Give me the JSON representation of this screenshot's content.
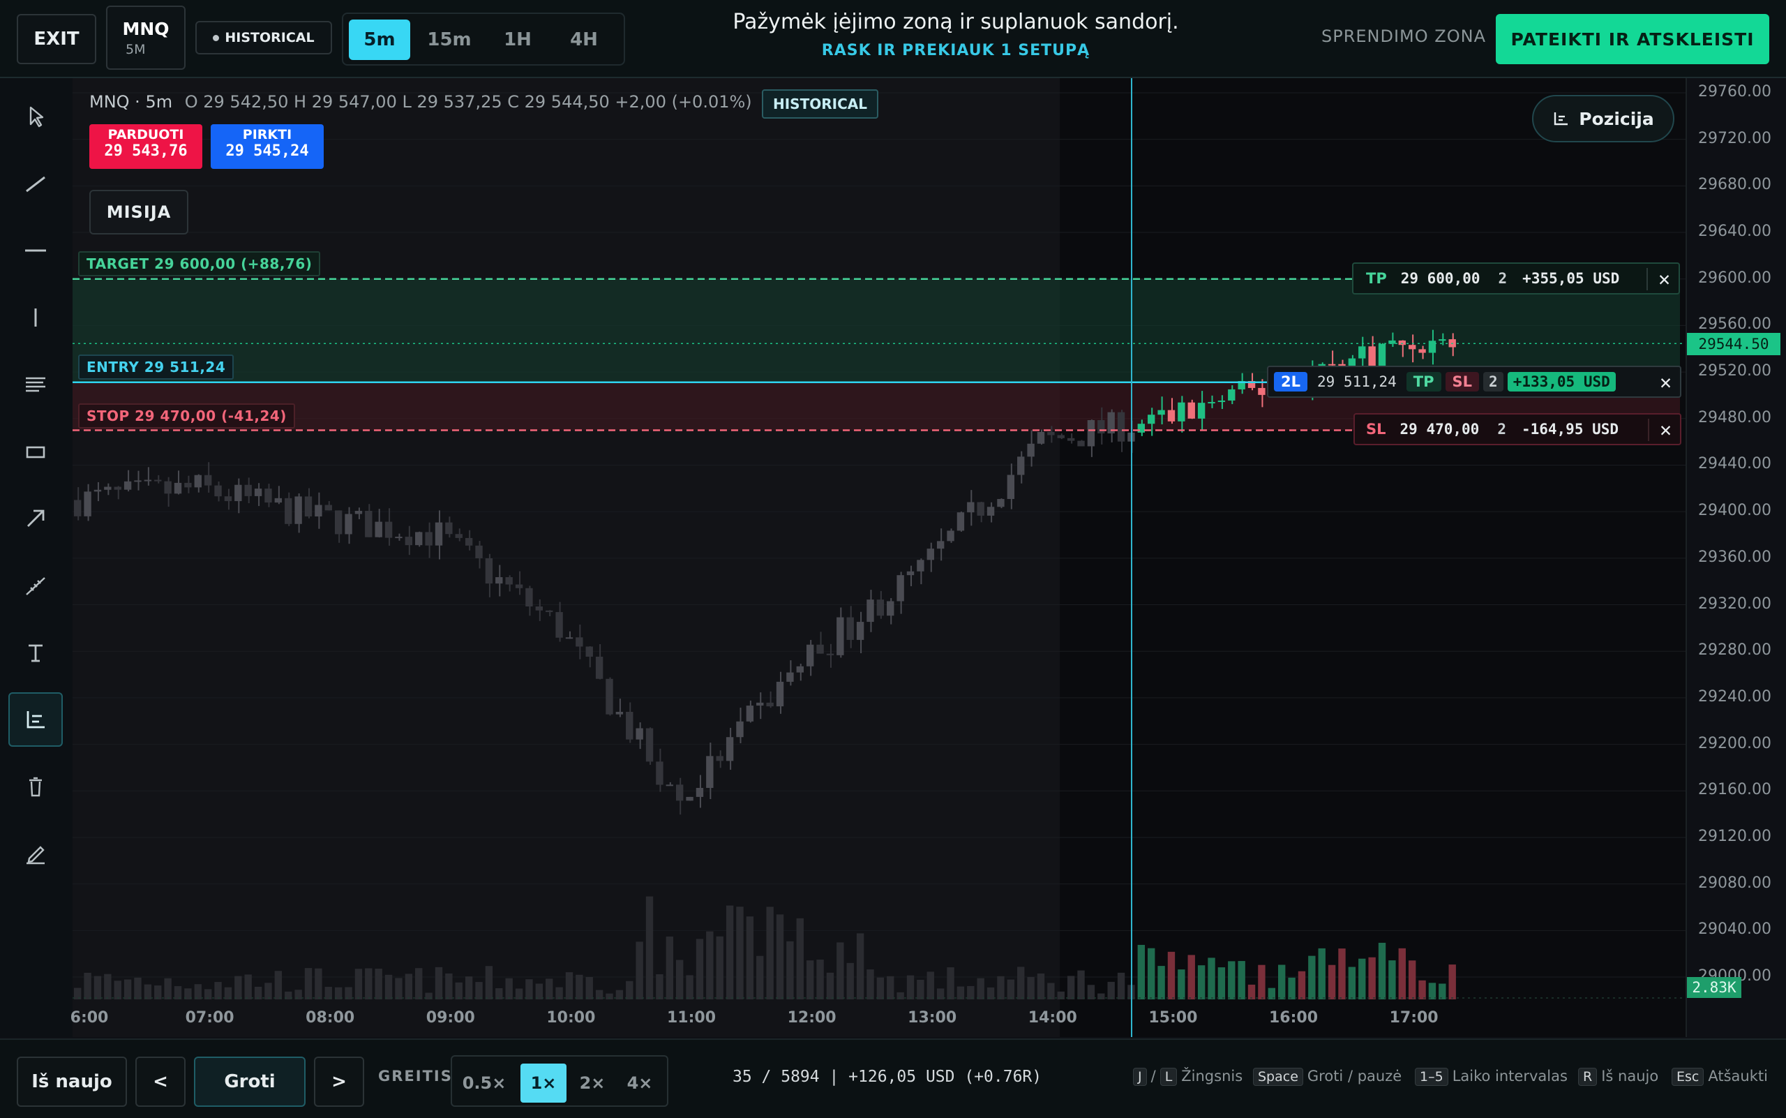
{
  "top": {
    "exit": "EXIT",
    "symbol": "MNQ",
    "symbol_tf": "5M",
    "historical": "HISTORICAL",
    "timeframes": [
      "5m",
      "15m",
      "1H",
      "4H"
    ],
    "active_timeframe": "5m",
    "instruction_title": "Pažymėk įėjimo zoną ir suplanuok sandorį.",
    "instruction_sub": "RASK IR PREKIAUK 1 SETUPĄ",
    "zone_label": "SPRENDIMO ZONA",
    "submit": "PATEIKTI IR ATSKLEISTI"
  },
  "legend": {
    "title": "MNQ · 5m",
    "ohlc": "O 29 542,50 H 29 547,00 L 29 537,25 C 29 544,50 +2,00 (+0.01%)",
    "badge": "HISTORICAL",
    "sell_label": "PARDUOTI",
    "sell_price": "29 543,76",
    "buy_label": "PIRKTI",
    "buy_price": "29 545,24",
    "mission": "MISIJA",
    "position_button": "Pozicija"
  },
  "levels": {
    "target": "TARGET 29 600,00 (+88,76)",
    "entry": "ENTRY 29 511,24",
    "stop": "STOP 29 470,00 (-41,24)"
  },
  "orders": {
    "tp": {
      "tag": "TP",
      "price": "29 600,00",
      "qty": "2",
      "pnl": "+355,05 USD",
      "close": "✕"
    },
    "pos": {
      "tag": "2L",
      "price": "29 511,24",
      "tp": "TP",
      "sl": "SL",
      "qty": "2",
      "pnl": "+133,05 USD",
      "close": "✕"
    },
    "sl": {
      "tag": "SL",
      "price": "29 470,00",
      "qty": "2",
      "pnl": "-164,95 USD",
      "close": "✕"
    }
  },
  "axis": {
    "prices": [
      "29760.00",
      "29720.00",
      "29680.00",
      "29640.00",
      "29600.00",
      "29560.00",
      "29520.00",
      "29480.00",
      "29440.00",
      "29400.00",
      "29360.00",
      "29320.00",
      "29280.00",
      "29240.00",
      "29200.00",
      "29160.00",
      "29120.00",
      "29080.00",
      "29040.00",
      "29000.00"
    ],
    "current_price": "29544.50",
    "volume_badge": "2.83K",
    "times": [
      "6:00",
      "07:00",
      "08:00",
      "09:00",
      "10:00",
      "11:00",
      "12:00",
      "13:00",
      "14:00",
      "15:00",
      "16:00",
      "17:00"
    ]
  },
  "chart_data": {
    "type": "candlestick",
    "symbol": "MNQ",
    "interval": "5m",
    "ylim": [
      29000,
      29760
    ],
    "x": [
      "06:00",
      "07:00",
      "08:00",
      "09:00",
      "10:00",
      "11:00",
      "12:00",
      "13:00",
      "14:00",
      "15:00",
      "16:00",
      "17:00"
    ],
    "closes_hourly_approx": [
      29410,
      29420,
      29395,
      29380,
      29300,
      29150,
      29270,
      29350,
      29460,
      29480,
      29510,
      29545
    ],
    "levels": {
      "target": 29600.0,
      "entry": 29511.24,
      "stop": 29470.0,
      "last": 29544.5
    },
    "volume_last": "2.83K"
  },
  "bottom": {
    "restart": "Iš naujo",
    "prev": "<",
    "play": "Groti",
    "next": ">",
    "speed_label": "GREITIS",
    "speeds": [
      "0.5×",
      "1×",
      "2×",
      "4×"
    ],
    "active_speed": "1×",
    "progress": "35 / 5894 | +126,05 USD (+0.76R)",
    "hints": [
      {
        "keys": [
          "J",
          "L"
        ],
        "sep": "/",
        "text": "Žingsnis"
      },
      {
        "keys": [
          "Space"
        ],
        "text": "Groti / pauzė"
      },
      {
        "keys": [
          "1–5"
        ],
        "text": "Laiko intervalas"
      },
      {
        "keys": [
          "R"
        ],
        "text": "Iš naujo"
      },
      {
        "keys": [
          "Esc"
        ],
        "text": "Atšaukti"
      }
    ]
  },
  "colors": {
    "accent": "#38d7f4",
    "buy": "#1469f5",
    "sell": "#ef1745",
    "up": "#1fbf83",
    "down": "#f0707a",
    "target": "#46d49a",
    "stop": "#f3667a"
  }
}
